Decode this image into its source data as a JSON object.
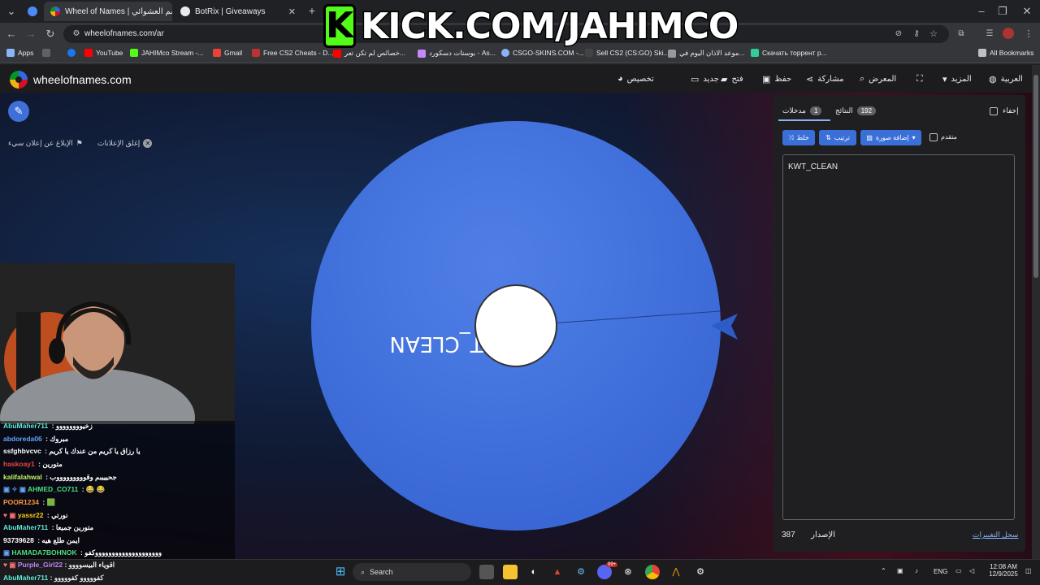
{
  "browser": {
    "tabs": [
      {
        "label": "Wheel of Names | الاسم العشوائي",
        "active": true
      },
      {
        "label": "BotRix | Giveaways",
        "active": false
      }
    ],
    "new_tab": "+",
    "url": "wheelofnames.com/ar",
    "bookmarks": [
      {
        "label": "Apps",
        "color": "#8ab4f8"
      },
      {
        "label": "",
        "color": "#5f6368"
      },
      {
        "label": "",
        "color": "#1877f2"
      },
      {
        "label": "YouTube",
        "color": "#ff0000"
      },
      {
        "label": "JAHIMco Stream -...",
        "color": "#53fc18"
      },
      {
        "label": "Gmail",
        "color": "#ea4335"
      },
      {
        "label": "Free CS2 Cheats - D...",
        "color": "#b33"
      },
      {
        "label": "خصائص لم تكن تعر...",
        "color": "#ff0000"
      },
      {
        "label": "بوستات دسكورد - As...",
        "color": "#c58af9"
      },
      {
        "label": "CSGO-SKINS.COM -...",
        "color": "#8ab4f8"
      },
      {
        "label": "Sell CS2 (CS:GO) Ski...",
        "color": "#444"
      },
      {
        "label": "موعد الاذان اليوم في...",
        "color": "#999"
      },
      {
        "label": "Скачать торрент p...",
        "color": "#3c9"
      },
      {
        "label": "All Bookmarks",
        "color": "#bdc1c6"
      }
    ]
  },
  "banner": {
    "logo_letter": "K",
    "text": "KICK.COM/JAHIMCO"
  },
  "site": {
    "brand": "wheelofnames.com",
    "nav": {
      "customize": "تخصيص",
      "new": "جديد",
      "open": "فتح",
      "save": "حفظ",
      "share": "مشاركة",
      "gallery": "المعرض",
      "more": "المزيد",
      "language": "العربية"
    },
    "close_ads": "إغلق الإعلانات",
    "report_ad": "الإبلاغ عن إعلان سيء"
  },
  "wheel": {
    "entry_text": "KWT_CLEAN",
    "color": "#3f6fd9"
  },
  "panel": {
    "hide_label": "إخفاء",
    "tab_entries": "مدخلات",
    "tab_entries_count": "1",
    "tab_results": "النتائج",
    "tab_results_count": "192",
    "shuffle": "خلط",
    "sort": "ترتيب",
    "add_image": "إضافة صورة",
    "advanced": "متقدم",
    "entries_text": "KWT_CLEAN",
    "version_label": "الإصدار",
    "version_number": "387",
    "changelog": "سجل التغييرات"
  },
  "chat": [
    {
      "user": "AbuMaher711",
      "text": "زخيوووووووو",
      "color": "#5eead4"
    },
    {
      "user": "abdoreda06",
      "text": "مبروك",
      "color": "#60a5fa"
    },
    {
      "user": "ssfghbvcvc",
      "text": "يا رزاق يا كريم من عندك يا كريم",
      "color": "#ffffff"
    },
    {
      "user": "haskoay1",
      "text": "متورين",
      "color": "#ef4444"
    },
    {
      "user": "kalifalahwal",
      "text": "جحيييبم وقوووووووووب",
      "color": "#bef264"
    },
    {
      "user": "AHMED_CO711",
      "text": "😂 😂",
      "color": "#4ade80"
    },
    {
      "user": "POOR1234",
      "text": "🟩",
      "color": "#fb923c"
    },
    {
      "user": "yassr22",
      "text": "نورتي",
      "color": "#facc15"
    },
    {
      "user": "AbuMaher711",
      "text": "متورين جميعا",
      "color": "#5eead4"
    },
    {
      "user": "93739628",
      "text": "ايمن طلع هيه",
      "color": "#ffffff"
    },
    {
      "user": "HAMADA7BOHNOK",
      "text": "ووووووووووووووووووووكفو",
      "color": "#4ade80"
    },
    {
      "user": "Purple_Girl22",
      "text": "اقوياء البيسوووو",
      "color": "#c084fc"
    },
    {
      "user": "AbuMaher711",
      "text": "كفووووو كفووووو",
      "color": "#5eead4"
    }
  ],
  "taskbar": {
    "search": "Search",
    "lang": "ENG",
    "time": "12:08 AM",
    "date": "12/9/2025",
    "badge": "99+"
  }
}
